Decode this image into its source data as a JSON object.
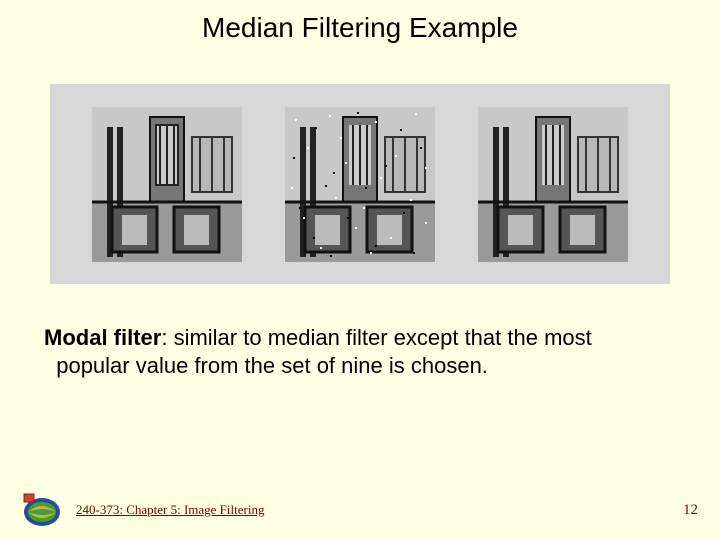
{
  "title": "Median Filtering Example",
  "body": {
    "bold": "Modal filter",
    "rest": ": similar to median filter except that the most   popular value from the set of nine is chosen."
  },
  "footer": {
    "chapter": "240-373: Chapter 5: Image Filtering",
    "page": "12"
  },
  "images": {
    "alt1": "original-circuit-image",
    "alt2": "noisy-circuit-image",
    "alt3": "filtered-circuit-image"
  }
}
